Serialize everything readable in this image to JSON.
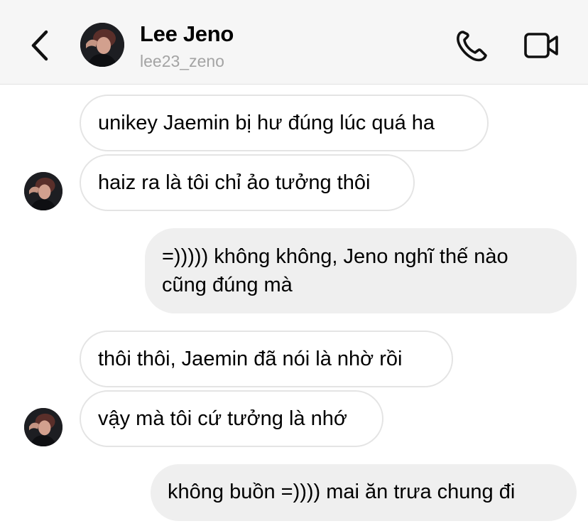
{
  "header": {
    "contact_name": "Lee Jeno",
    "contact_handle": "lee23_zeno",
    "icons": {
      "back": "chevron-left-icon",
      "call": "phone-icon",
      "video": "video-camera-icon"
    }
  },
  "messages": [
    {
      "sender": "them",
      "text": "unikey Jaemin bị hư đúng lúc quá ha"
    },
    {
      "sender": "them",
      "text": "haiz ra là tôi chỉ ảo tưởng thôi"
    },
    {
      "sender": "me",
      "lines": [
        "=))))) không không, Jeno nghĩ thế nào",
        "cũng đúng mà"
      ]
    },
    {
      "sender": "them",
      "text": "thôi thôi, Jaemin đã nói là nhờ rồi"
    },
    {
      "sender": "them",
      "text": "vậy mà tôi cứ tưởng là nhớ"
    },
    {
      "sender": "me",
      "text": "không buồn =)))) mai ăn trưa chung đi"
    }
  ]
}
